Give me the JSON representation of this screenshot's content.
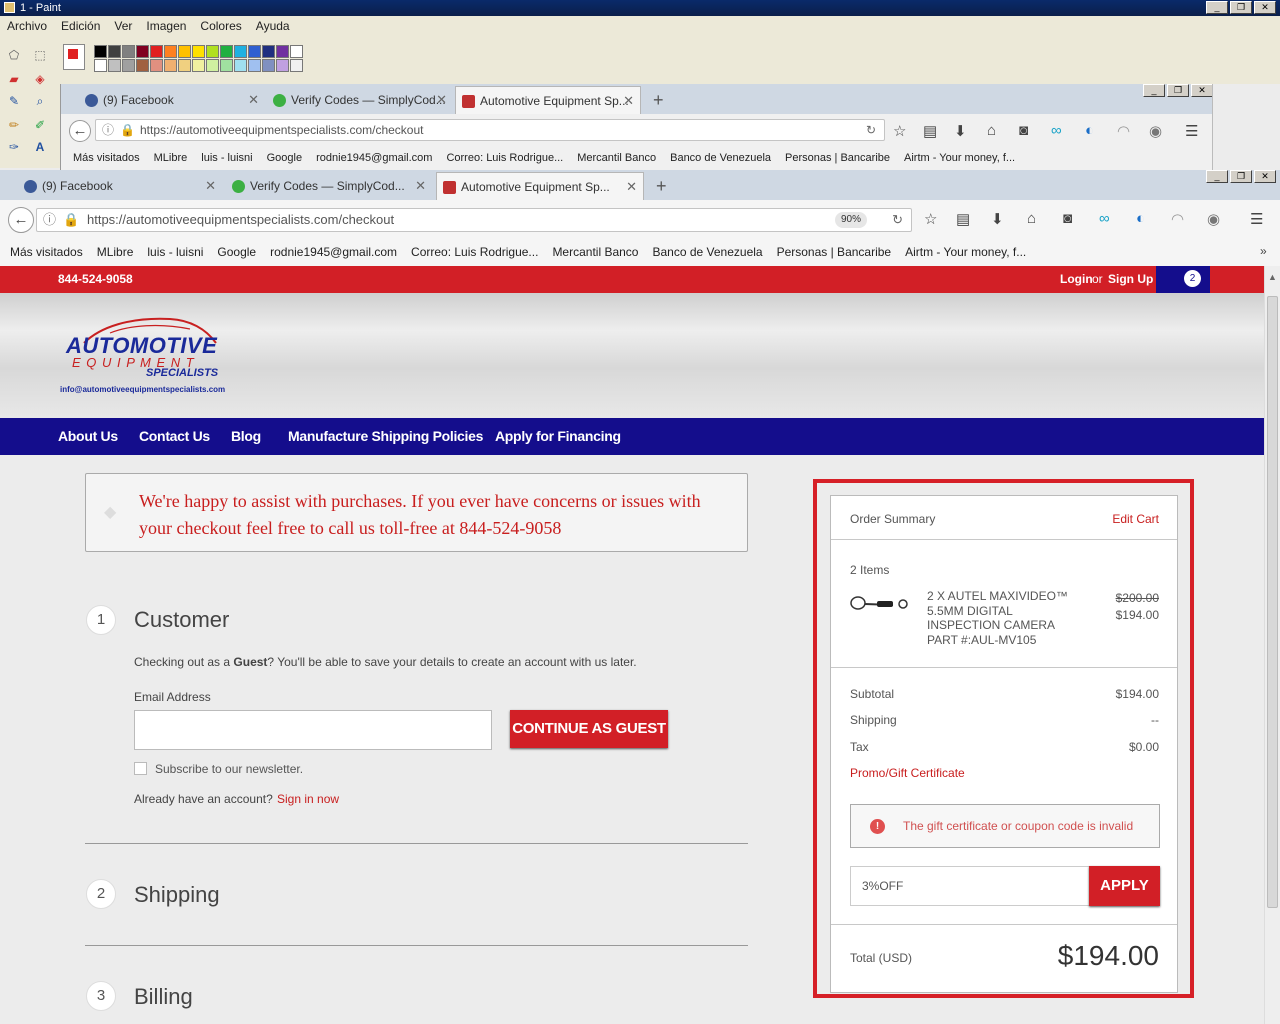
{
  "paint": {
    "title": "1 - Paint",
    "menu": [
      "Archivo",
      "Edición",
      "Ver",
      "Imagen",
      "Colores",
      "Ayuda"
    ],
    "palette_top": [
      "#000000",
      "#404040",
      "#808080",
      "#800020",
      "#e02020",
      "#ff8020",
      "#ffc000",
      "#ffe000",
      "#b0e020",
      "#20b040",
      "#20b0e0",
      "#3060d0",
      "#203080",
      "#7030a0",
      "#ffffff"
    ],
    "palette_bottom": [
      "#ffffff",
      "#c0c0c0",
      "#a0a0a0",
      "#a06040",
      "#e09080",
      "#f0b070",
      "#f0d080",
      "#f0f0a0",
      "#d0f0a0",
      "#a0e0a0",
      "#a0e0f0",
      "#a0c0f0",
      "#8090c0",
      "#c0a0e0",
      "#f0f0f0"
    ]
  },
  "browser_back": {
    "tabs": [
      "(9) Facebook",
      "Verify Codes — SimplyCod...",
      "Automotive Equipment Sp..."
    ],
    "url": "https://automotiveequipmentspecialists.com/checkout",
    "bookmarks": [
      "Más visitados",
      "MLibre",
      "luis - luisni",
      "Google",
      "rodnie1945@gmail.com",
      "Correo: Luis Rodrigue...",
      "Mercantil Banco",
      "Banco de Venezuela",
      "Personas | Bancaribe",
      "Airtm - Your money, f..."
    ]
  },
  "browser_front": {
    "tabs": [
      "(9) Facebook",
      "Verify Codes — SimplyCod...",
      "Automotive Equipment Sp..."
    ],
    "url": "https://automotiveequipmentspecialists.com/checkout",
    "zoom": "90%",
    "bookmarks": [
      "Más visitados",
      "MLibre",
      "luis - luisni",
      "Google",
      "rodnie1945@gmail.com",
      "Correo: Luis Rodrigue...",
      "Mercantil Banco",
      "Banco de Venezuela",
      "Personas | Bancaribe",
      "Airtm - Your money, f..."
    ]
  },
  "site": {
    "phone": "844-524-9058",
    "login": "Login",
    "or": "or",
    "signup": "Sign Up",
    "cart_count": "2",
    "logo_line1": "AUTOMOTIVE",
    "logo_line2": "E Q U I P M E N T",
    "logo_line3": "SPECIALISTS",
    "logo_email": "info@automotiveequipmentspecialists.com",
    "nav": [
      "About Us",
      "Contact Us",
      "Blog",
      "Manufacture Shipping Policies",
      "Apply for Financing"
    ],
    "notice": "We're happy to assist with purchases. If you ever have concerns or issues with your checkout feel free to call us toll-free at 844-524-9058"
  },
  "checkout": {
    "step1_num": "1",
    "step1_title": "Customer",
    "guest_pre": "Checking out as a ",
    "guest_bold": "Guest",
    "guest_post": "? You'll be able to save your details to create an account with us later.",
    "email_label": "Email Address",
    "email_value": "",
    "continue_label": "CONTINUE AS GUEST",
    "newsletter_label": "Subscribe to our newsletter.",
    "already_account": "Already have an account?",
    "sign_in": "Sign in now",
    "step2_num": "2",
    "step2_title": "Shipping",
    "step3_num": "3",
    "step3_title": "Billing"
  },
  "summary": {
    "title": "Order Summary",
    "edit_cart": "Edit Cart",
    "items_count": "2 Items",
    "item_name": "2 X AUTEL MAXIVIDEO™ 5.5MM DIGITAL INSPECTION CAMERA PART #:AUL-MV105",
    "item_old_price": "$200.00",
    "item_price": "$194.00",
    "subtotal_label": "Subtotal",
    "subtotal_value": "$194.00",
    "shipping_label": "Shipping",
    "shipping_value": "--",
    "tax_label": "Tax",
    "tax_value": "$0.00",
    "promo_label": "Promo/Gift Certificate",
    "error_text": "The gift certificate or coupon code is invalid",
    "coupon_value": "3%OFF",
    "apply_label": "APPLY",
    "total_label": "Total (USD)",
    "total_value": "$194.00"
  },
  "colors": {
    "brand_red": "#d21f26",
    "nav_blue": "#140d8c"
  }
}
